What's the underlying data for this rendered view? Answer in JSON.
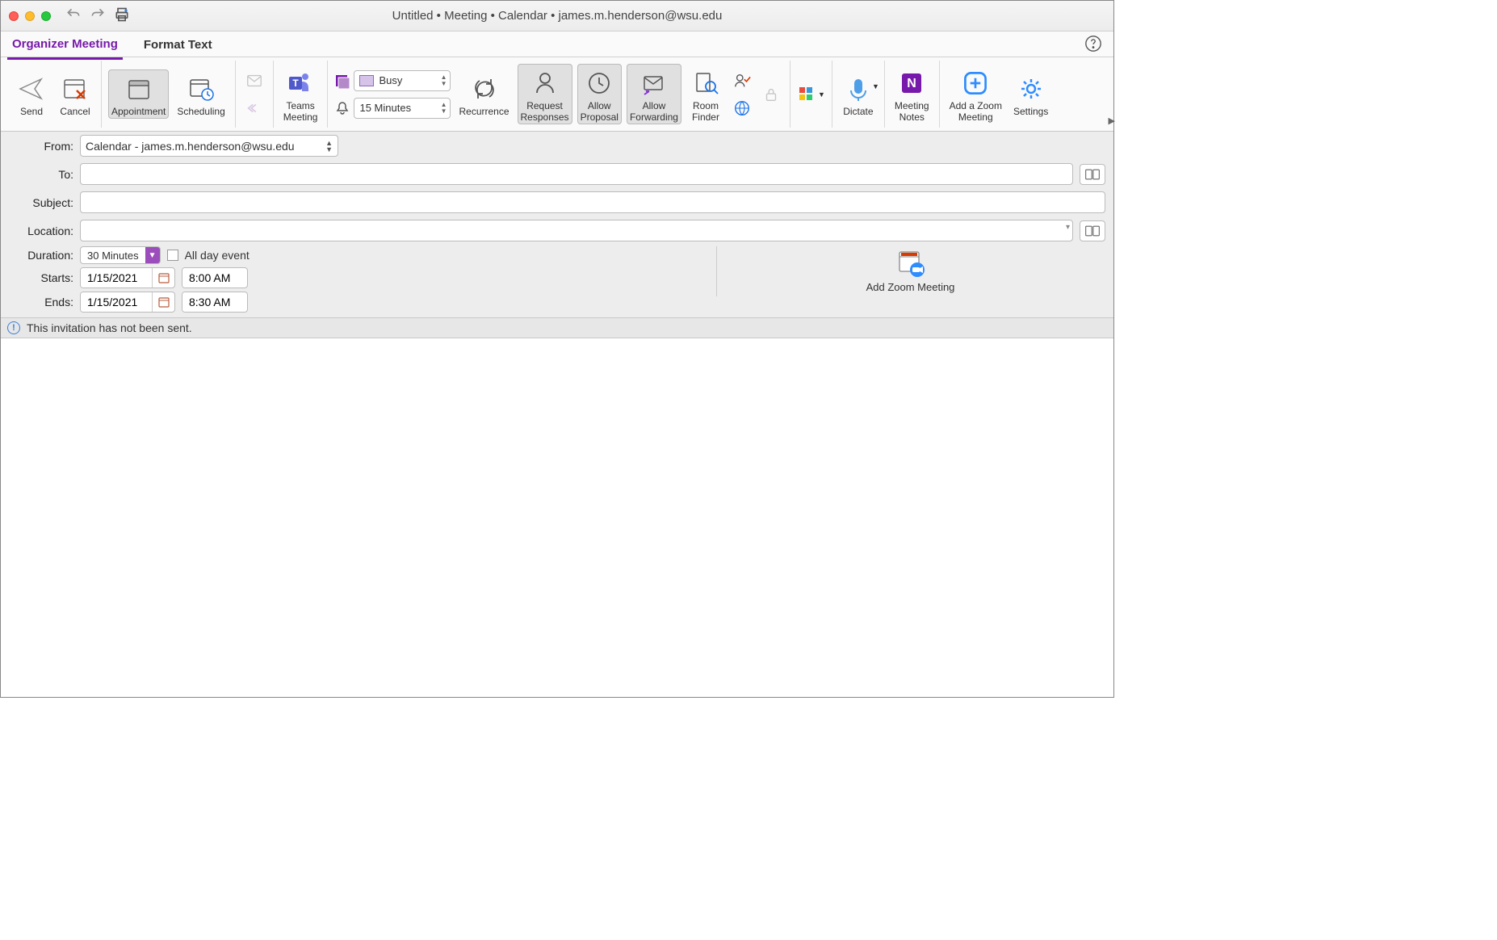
{
  "window": {
    "title": "Untitled • Meeting • Calendar • james.m.henderson@wsu.edu"
  },
  "tabs": {
    "organizer": "Organizer Meeting",
    "format": "Format Text"
  },
  "ribbon": {
    "send": "Send",
    "cancel": "Cancel",
    "appointment": "Appointment",
    "scheduling": "Scheduling",
    "teams": "Teams\nMeeting",
    "status_value": "Busy",
    "reminder_value": "15 Minutes",
    "recurrence": "Recurrence",
    "request_responses": "Request\nResponses",
    "allow_proposal": "Allow\nProposal",
    "allow_forwarding": "Allow\nForwarding",
    "room_finder": "Room\nFinder",
    "dictate": "Dictate",
    "meeting_notes": "Meeting\nNotes",
    "add_zoom": "Add a Zoom\nMeeting",
    "settings": "Settings"
  },
  "form": {
    "from_label": "From:",
    "from_value": "Calendar - james.m.henderson@wsu.edu",
    "to_label": "To:",
    "to_value": "",
    "subject_label": "Subject:",
    "subject_value": "",
    "location_label": "Location:",
    "location_value": "",
    "duration_label": "Duration:",
    "duration_value": "30 Minutes",
    "allday_label": "All day event",
    "starts_label": "Starts:",
    "start_date": "1/15/2021",
    "start_time": "8:00 AM",
    "ends_label": "Ends:",
    "end_date": "1/15/2021",
    "end_time": "8:30 AM",
    "zoom_panel_label": "Add Zoom Meeting"
  },
  "info_bar": {
    "message": "This invitation has not been sent."
  }
}
